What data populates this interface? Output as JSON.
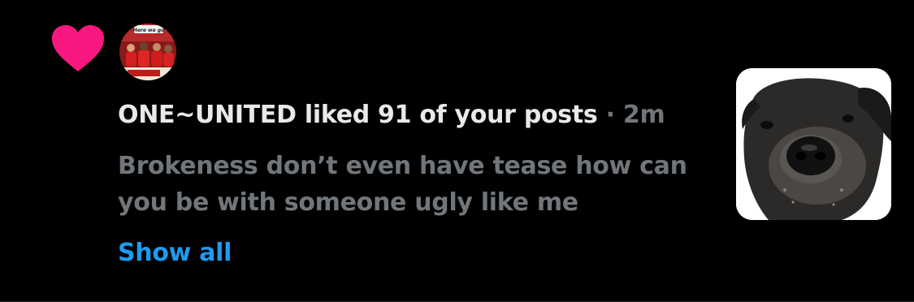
{
  "notification": {
    "type_icon": "heart-icon",
    "actor": "ONE~UNITED",
    "action": " liked 91 of your posts",
    "separator": "·",
    "time": "2m",
    "excerpt_line1": "Brokeness don’t even have tease how can",
    "excerpt_line2": "you be with someone ugly like me",
    "show_all_label": "Show all",
    "avatar_banner_text": "Here we go"
  },
  "colors": {
    "background": "#000000",
    "heart": "#f91880",
    "primary_text": "#e7e9ea",
    "secondary_text": "#71767b",
    "link": "#1d9bf0"
  }
}
